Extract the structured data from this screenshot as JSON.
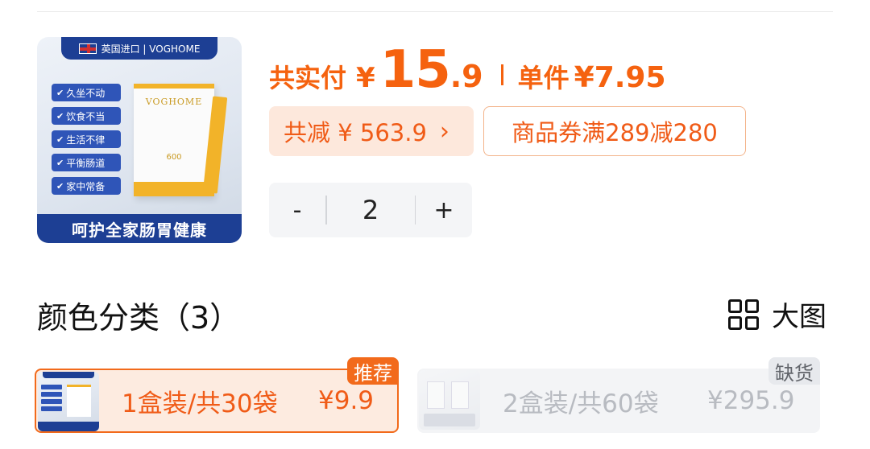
{
  "product": {
    "thumb_banner": "英国进口 | VOGHOME",
    "thumb_tags": [
      "久坐不动",
      "饮食不当",
      "生活不律",
      "平衡肠道",
      "家中常备"
    ],
    "thumb_box_brand": "VOGHOME",
    "thumb_box_num": "600",
    "thumb_footer": "呵护全家肠胃健康"
  },
  "price": {
    "total_label": "共实付",
    "currency": "¥",
    "total_int": "15",
    "total_dec": ".9",
    "unit_label": "单件",
    "unit_price": "¥7.95"
  },
  "discount": {
    "label": "共减 ¥ 563.9",
    "chevron": "›",
    "coupon": "商品券满289减280"
  },
  "quantity": {
    "minus": "-",
    "value": "2",
    "plus": "+"
  },
  "section": {
    "title": "颜色分类（3）",
    "view_label": "大图",
    "view_icon": "grid-icon"
  },
  "variants": [
    {
      "label": "1盒装/共30袋",
      "price": "¥9.9",
      "badge": "推荐",
      "selected": true
    },
    {
      "label": "2盒装/共60袋",
      "price": "¥295.9",
      "badge": "缺货",
      "disabled": true
    }
  ],
  "colors": {
    "accent": "#f5620f",
    "brand_blue": "#1d3f94",
    "discount_bg": "#fde8dc"
  }
}
